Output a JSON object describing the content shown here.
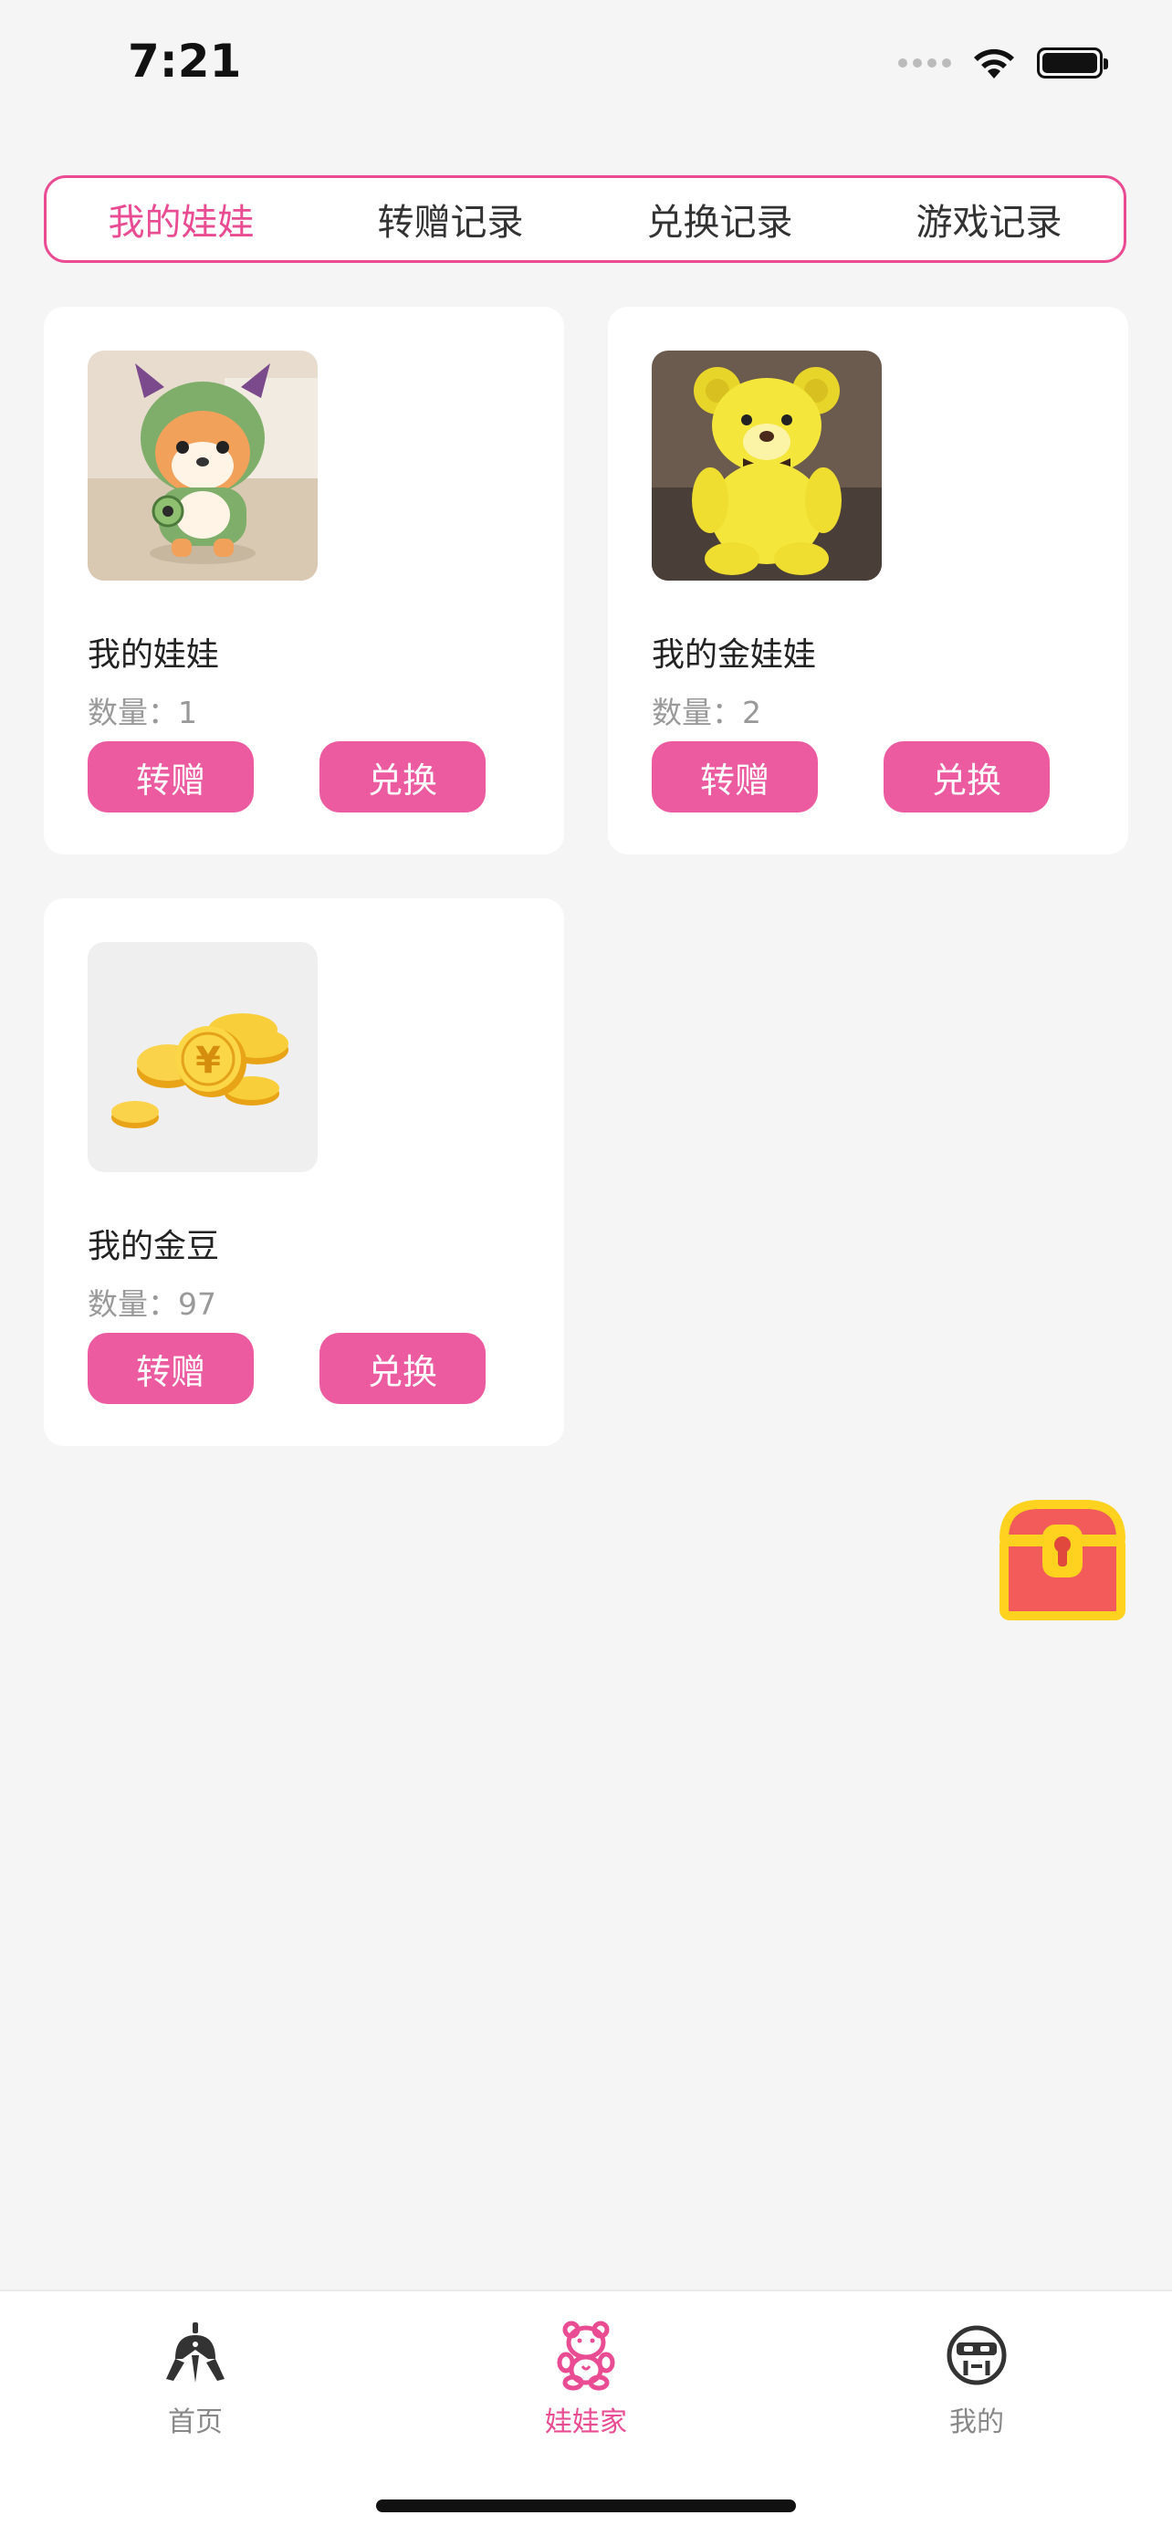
{
  "status_bar": {
    "time": "7:21"
  },
  "tabs": [
    {
      "label": "我的娃娃",
      "active": true
    },
    {
      "label": "转赠记录",
      "active": false
    },
    {
      "label": "兑换记录",
      "active": false
    },
    {
      "label": "游戏记录",
      "active": false
    }
  ],
  "cards": [
    {
      "name": "我的娃娃",
      "quantity_label": "数量：",
      "quantity": "1",
      "transfer_label": "转赠",
      "exchange_label": "兑换",
      "image": "plush-dino-costume-dog"
    },
    {
      "name": "我的金娃娃",
      "quantity_label": "数量：",
      "quantity": "2",
      "transfer_label": "转赠",
      "exchange_label": "兑换",
      "image": "yellow-teddy-bear"
    },
    {
      "name": "我的金豆",
      "quantity_label": "数量：",
      "quantity": "97",
      "transfer_label": "转赠",
      "exchange_label": "兑换",
      "image": "gold-coins"
    }
  ],
  "floating": {
    "icon": "treasure-chest-icon"
  },
  "tabbar": [
    {
      "label": "首页",
      "icon": "claw-machine-icon",
      "active": false
    },
    {
      "label": "娃娃家",
      "icon": "teddy-bear-icon",
      "active": true
    },
    {
      "label": "我的",
      "icon": "profile-face-icon",
      "active": false
    }
  ],
  "colors": {
    "accent": "#e94c93",
    "button": "#ec5aa0",
    "background": "#f5f5f5"
  }
}
